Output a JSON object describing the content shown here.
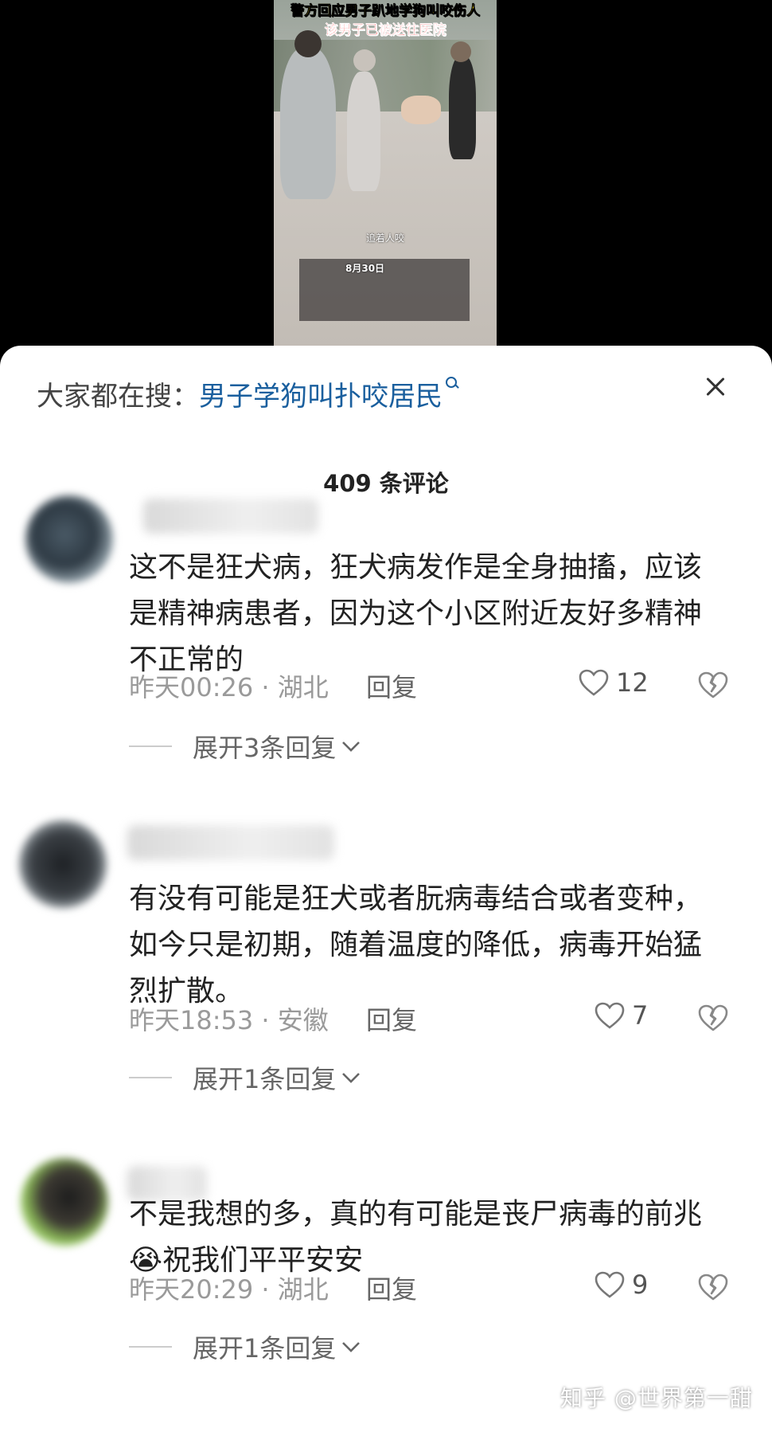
{
  "video": {
    "headline_line1": "警方回应男子趴地学狗叫咬伤人",
    "headline_line2": "该男子已被送往医院",
    "caption": "追着人咬",
    "date": "8月30日"
  },
  "search_bar": {
    "prefix": "大家都在搜：",
    "term": "男子学狗叫扑咬居民"
  },
  "comments_header": {
    "count_label": "409 条评论"
  },
  "comments": [
    {
      "text": "这不是狂犬病，狂犬病发作是全身抽搐，应该是精神病患者，因为这个小区附近友好多精神不正常的",
      "time_location": "昨天00:26 · 湖北",
      "reply_label": "回复",
      "likes": "12",
      "expand_label": "展开3条回复"
    },
    {
      "text": "有没有可能是狂犬或者朊病毒结合或者变种，如今只是初期，随着温度的降低，病毒开始猛烈扩散。",
      "time_location": "昨天18:53 · 安徽",
      "reply_label": "回复",
      "likes": "7",
      "expand_label": "展开1条回复"
    },
    {
      "text": "不是我想的多，真的有可能是丧尸病毒的前兆😭祝我们平平安安",
      "time_location": "昨天20:29 · 湖北",
      "reply_label": "回复",
      "likes": "9",
      "expand_label": "展开1条回复"
    }
  ],
  "watermark": "知乎 @世界第一甜",
  "colors": {
    "link_blue": "#1a5f9e",
    "meta_gray": "#9a9a9a",
    "text": "#222222"
  }
}
